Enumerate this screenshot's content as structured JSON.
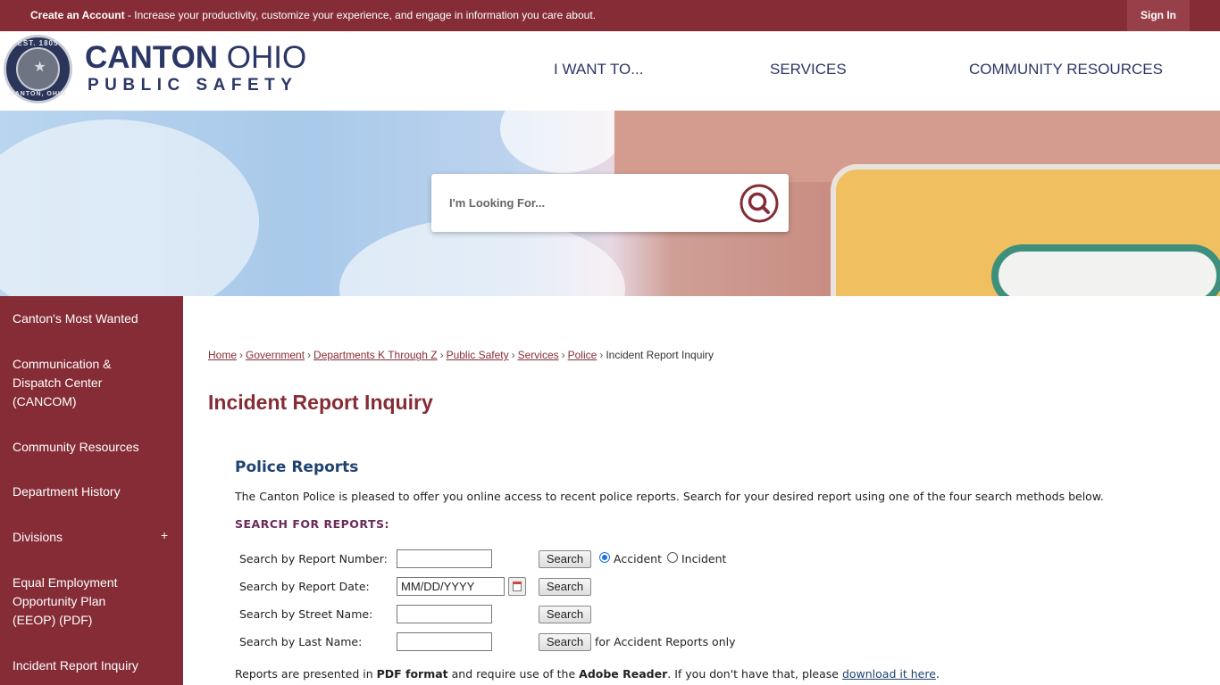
{
  "topbar": {
    "create_label": "Create an Account",
    "create_rest": " - Increase your productivity, customize your experience, and engage in information you care about.",
    "signin_label": "Sign In"
  },
  "header": {
    "seal_top": "EST. 1805",
    "seal_bottom": "CANTON, OHIO",
    "brand_bold": "CANTON",
    "brand_light": " OHIO",
    "brand_sub": "PUBLIC SAFETY",
    "nav": [
      "I WANT TO...",
      "SERVICES",
      "COMMUNITY RESOURCES"
    ]
  },
  "hero_search": {
    "placeholder": "I'm Looking For..."
  },
  "sidebar": {
    "items": [
      "Canton's Most Wanted",
      "Communication & Dispatch Center (CANCOM)",
      "Community Resources",
      "Department History",
      "Divisions",
      "Equal Employment Opportunity Plan (EEOP) (PDF)",
      "Incident Report Inquiry"
    ],
    "expand_symbol": "+"
  },
  "breadcrumb": {
    "links": [
      "Home",
      "Government",
      "Departments K Through Z",
      "Public Safety",
      "Services",
      "Police"
    ],
    "current": "Incident Report Inquiry",
    "separator": "›"
  },
  "page_title": "Incident Report Inquiry",
  "section": {
    "title": "Police Reports",
    "intro": "The Canton Police is pleased to offer you online access to recent police reports. Search for your desired report using one of the four search methods below.",
    "search_heading": "SEARCH FOR REPORTS:"
  },
  "form": {
    "rows": [
      {
        "label": "Search  by Report Number:",
        "value": "",
        "button": "Search"
      },
      {
        "label": "Search  by Report Date:",
        "value": "MM/DD/YYYY",
        "button": "Search"
      },
      {
        "label": "Search  by Street Name:",
        "value": "",
        "button": "Search"
      },
      {
        "label": "Search  by Last Name:",
        "value": "",
        "button": "Search"
      }
    ],
    "radio_accident": "Accident",
    "radio_incident": "Incident",
    "lastname_note": "for Accident Reports only"
  },
  "note": {
    "p1": "Reports are presented in ",
    "b1": "PDF format",
    "p2": " and require use of the ",
    "b2": "Adobe Reader",
    "p3": ". If you don't have that, please ",
    "link": "download it here",
    "p4": "."
  },
  "colors": {
    "brand_maroon": "#852c36",
    "brand_navy": "#2b3766",
    "section_blue": "#1f4270"
  }
}
